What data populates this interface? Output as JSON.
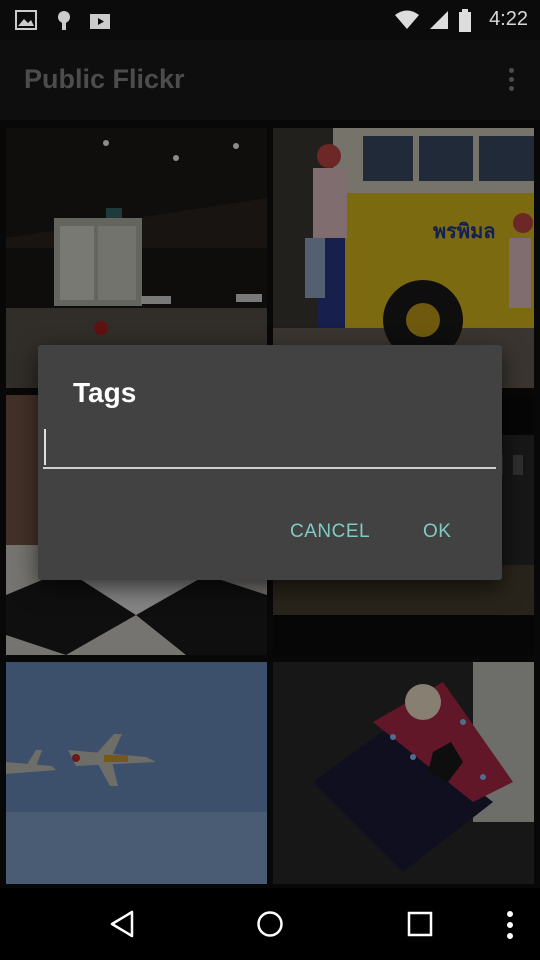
{
  "status_bar": {
    "time": "4:22",
    "left_icons": [
      "gallery-notification-icon",
      "android-debug-icon",
      "media-notification-icon"
    ],
    "right_icons": [
      "wifi-icon",
      "signal-icon",
      "battery-icon"
    ]
  },
  "app_bar": {
    "title": "Public Flickr",
    "overflow_icon": "more-vert-icon"
  },
  "photos": [
    {
      "subject": "train station interior"
    },
    {
      "subject": "yellow bus with people in santa hats"
    },
    {
      "subject": "plaza with buildings"
    },
    {
      "subject": "dark outdoor scene"
    },
    {
      "subject": "two jets in blue sky"
    },
    {
      "subject": "star-patterned gift box"
    }
  ],
  "dialog": {
    "title": "Tags",
    "input_value": "",
    "cancel_label": "CANCEL",
    "ok_label": "OK"
  },
  "nav_bar": {
    "icons": [
      "back-icon",
      "home-icon",
      "recents-icon",
      "more-vert-icon"
    ]
  },
  "colors": {
    "dialog_bg": "#424242",
    "button_text": "#7fcbc4",
    "app_bar": "#1a1a1a"
  }
}
